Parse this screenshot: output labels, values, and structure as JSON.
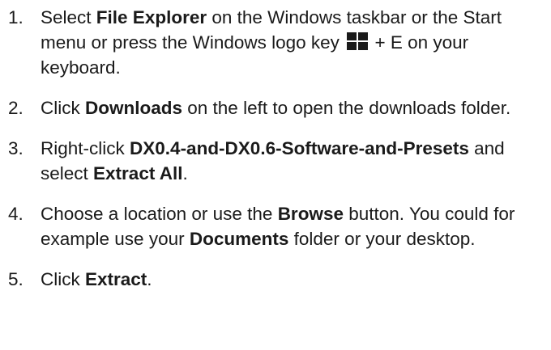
{
  "steps": [
    {
      "number": "1.",
      "parts": [
        "Select ",
        "File Explorer",
        " on the Windows taskbar or the Start menu or press the Windows logo key ",
        " + E on your keyboard."
      ]
    },
    {
      "number": "2.",
      "parts": [
        "Click ",
        "Downloads",
        " on the left to open the downloads folder."
      ]
    },
    {
      "number": "3.",
      "parts": [
        "Right-click ",
        "DX0.4-and-DX0.6-Software-and-Presets",
        " and select ",
        "Extract All",
        "."
      ]
    },
    {
      "number": "4.",
      "parts": [
        "Choose a location or use the ",
        "Browse",
        " button. You could for example use your ",
        "Documents",
        " folder or your desktop."
      ]
    },
    {
      "number": "5.",
      "parts": [
        "Click ",
        "Extract",
        "."
      ]
    }
  ],
  "icons": {
    "windows_logo": "windows-logo-icon"
  },
  "colors": {
    "text": "#1a1a1a",
    "background": "#ffffff"
  }
}
